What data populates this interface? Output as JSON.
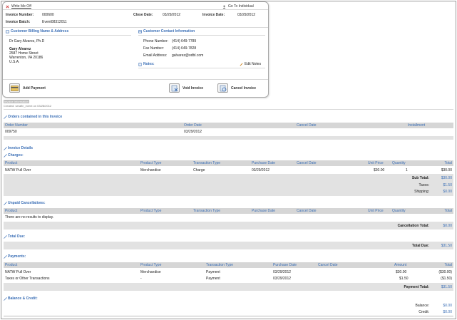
{
  "links": {
    "write_off": "Write Me Off",
    "go_individual": "Go To Individual"
  },
  "invoice": {
    "number_label": "Invoice Number:",
    "number": "000600",
    "batch_label": "Invoice Batch:",
    "batch": "Event08312011",
    "close_date_label": "Close Date:",
    "close_date": "03/29/2012",
    "invoice_date_label": "Invoice Date:",
    "invoice_date": "03/29/2012"
  },
  "billing": {
    "title": "Customer Billing Name & Address",
    "contact_name": "Dr Gary Alvarez, Ph.D",
    "name": "Gary Alvarez",
    "street": "2587 Home Street",
    "city": "Warrenton, VA 20186",
    "country": "U.S.A."
  },
  "contact": {
    "title": "Customer Contact Information",
    "phone_label": "Phone Number:",
    "phone": "(414) 649-7789",
    "fax_label": "Fax Number:",
    "fax": "(414) 649-7828",
    "email_label": "Email Address:",
    "email": "galvarez@odbl.com"
  },
  "notes": {
    "label": "Notes:",
    "edit": "Edit Notes"
  },
  "actions": {
    "add_payment": "Add Payment",
    "void_invoice": "Void Invoice",
    "cancel_invoice": "Cancel Invoice"
  },
  "meta": {
    "invoice_id": "Invoice Information",
    "created": "Created: serafin_event on 03/28/2012"
  },
  "orders": {
    "title": "Orders contained in this Invoice",
    "headers": [
      "Order Number",
      "Order Date",
      "Cancel Date",
      "Installment"
    ],
    "rows": [
      [
        "009750",
        "03/29/2012",
        "",
        ""
      ]
    ]
  },
  "details_title": "Invoice Details",
  "charges": {
    "title": "Charges:",
    "headers": [
      "Product",
      "Product Type",
      "Transaction Type",
      "Purchase Date",
      "Cancel Date",
      "Unit Price",
      "Quantity",
      "Total"
    ],
    "rows": [
      [
        "NATW Pull Over",
        "Merchandise",
        "Charge",
        "03/29/2012",
        "",
        "$30.00",
        "1",
        "$30.00"
      ]
    ],
    "subtotal_label": "Sub Total:",
    "subtotal": "$30.00",
    "taxes_label": "Taxes:",
    "taxes": "$1.50",
    "shipping_label": "Shipping:",
    "shipping": "$0.00"
  },
  "cancellations": {
    "title": "Unpaid Cancellations:",
    "headers": [
      "Product",
      "Product Type",
      "Transaction Type",
      "Purchase Date",
      "Cancel Date",
      "Unit Price",
      "Quantity",
      "Total"
    ],
    "empty": "There are no results to display.",
    "total_label": "Cancellation Total:",
    "total": "$0.00"
  },
  "total_due": {
    "title": "Total Due:",
    "label": "Total Due:",
    "value": "$31.50"
  },
  "payments": {
    "title": "Payments:",
    "headers": [
      "Product",
      "Product Type",
      "Transaction Type",
      "Purchase Date",
      "Cancel Date",
      "Amount",
      "Total"
    ],
    "rows": [
      [
        "NATW Pull Over",
        "Merchandise",
        "Payment",
        "03/29/2012",
        "",
        "$30.00",
        "($30.00)"
      ],
      [
        "Taxes or Other Transactions",
        "-",
        "Payment",
        "03/29/2012",
        "",
        "$1.50",
        "($1.50)"
      ]
    ],
    "total_label": "Payment Total:",
    "total": "$31.50"
  },
  "balance": {
    "title": "Balance & Credit:",
    "balance_label": "Balance:",
    "balance": "$0.00",
    "credit_label": "Credit:",
    "credit": "$0.00"
  },
  "colors": {
    "accent": "#3b6fb6",
    "header_bg": "#d6d6d6",
    "bar_bg": "#e2e2e2"
  }
}
